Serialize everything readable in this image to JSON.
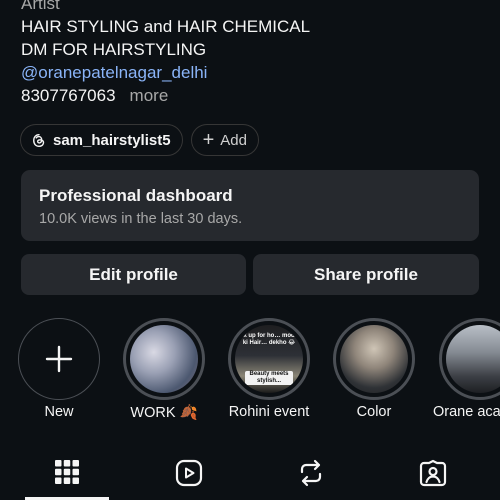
{
  "bio": {
    "category": "Artist",
    "line1": "HAIR STYLING and HAIR CHEMICAL",
    "line2": "DM FOR HAIRSTYLING",
    "handle_link": "@oranepatelnagar_delhi",
    "phone": "8307767063",
    "more": "more"
  },
  "chips": {
    "threads_handle": "sam_hairstylist5",
    "add_label": "Add"
  },
  "dashboard": {
    "title": "Professional dashboard",
    "subtitle": "10.0K views in the last 30 days."
  },
  "buttons": {
    "edit_profile": "Edit profile",
    "share_profile": "Share profile"
  },
  "highlights": {
    "new_label": "New",
    "items": [
      {
        "label": "WORK 🍂"
      },
      {
        "label": "Rohini event",
        "overlay_top": "...ck up for ho… models ki Hair… dekho 😂",
        "overlay_bottom": "Beauty meets stylish..."
      },
      {
        "label": "Color"
      },
      {
        "label": "Orane aca"
      }
    ]
  },
  "tabs": [
    "grid-icon",
    "reels-icon",
    "reposts-icon",
    "tagged-icon"
  ],
  "colors": {
    "background": "#0c1014",
    "surface": "#26292e",
    "link": "#8ab4f8",
    "muted": "#a8a8a8"
  }
}
